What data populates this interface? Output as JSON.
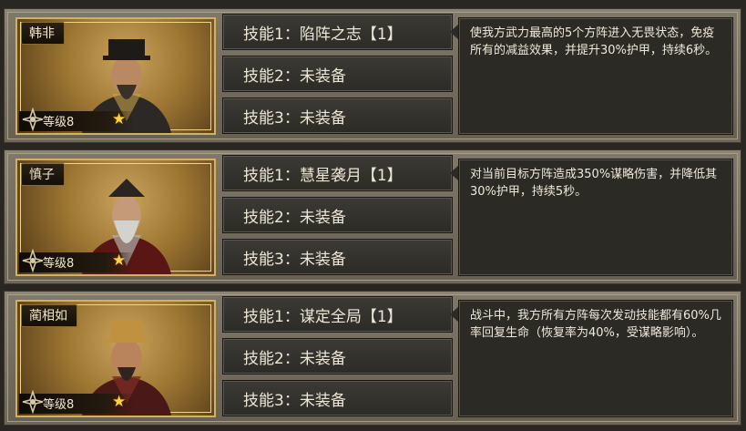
{
  "generals": [
    {
      "name": "韩非",
      "level_label": "等级8",
      "colors": {
        "robe": "#2b2825",
        "hat": "#1d1a17",
        "accent": "#c8a04a"
      },
      "skills": [
        "技能1：陷阵之志【1】",
        "技能2：未装备",
        "技能3：未装备"
      ],
      "description": "使我方武力最高的5个方阵进入无畏状态，免疫所有的减益效果，并提升30%护甲，持续6秒。"
    },
    {
      "name": "慎子",
      "level_label": "等级8",
      "colors": {
        "robe": "#5a1614",
        "hat": "#2a2522",
        "accent": "#b0b0aa"
      },
      "skills": [
        "技能1：慧星袭月【1】",
        "技能2：未装备",
        "技能3：未装备"
      ],
      "description": "对当前目标方阵造成350%谋略伤害，并降低其30%护甲，持续5秒。"
    },
    {
      "name": "蔺相如",
      "level_label": "等级8",
      "colors": {
        "robe": "#4a1816",
        "hat": "#c09240",
        "accent": "#7a2a24"
      },
      "skills": [
        "技能1：谋定全局【1】",
        "技能2：未装备",
        "技能3：未装备"
      ],
      "description": "战斗中，我方所有方阵每次发动技能都有60%几率回复生命（恢复率为40%，受谋略影响）。"
    }
  ],
  "icons": {
    "level_emblem": "sword-emblem-icon",
    "star": "star-icon"
  },
  "star_glyph": "★"
}
